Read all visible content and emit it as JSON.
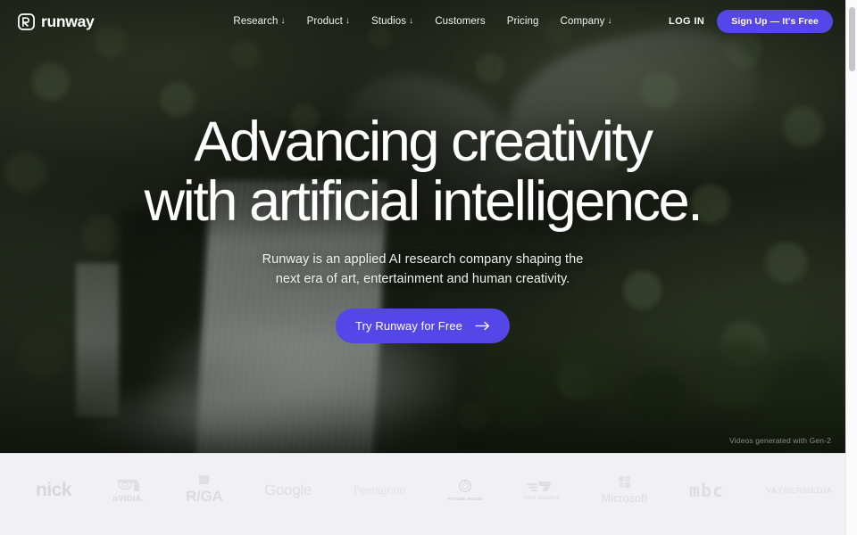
{
  "nav": {
    "logo_word": "runway",
    "links": [
      {
        "label": "Research",
        "caret": "↓"
      },
      {
        "label": "Product",
        "caret": "↓"
      },
      {
        "label": "Studios",
        "caret": "↓"
      },
      {
        "label": "Customers",
        "caret": ""
      },
      {
        "label": "Pricing",
        "caret": ""
      },
      {
        "label": "Company",
        "caret": "↓"
      }
    ],
    "login_label": "LOG IN",
    "signup_label": "Sign Up — It's Free"
  },
  "hero": {
    "headline_line1": "Advancing creativity",
    "headline_line2": "with artificial intelligence.",
    "subhead_line1": "Runway is an applied AI research company shaping the",
    "subhead_line2": "next era of art, entertainment and human creativity.",
    "cta_label": "Try Runway for Free",
    "caption": "Videos generated with Gen-2"
  },
  "logos": {
    "items": [
      {
        "name": "nick",
        "text": "nick"
      },
      {
        "name": "nvidia",
        "text": "nVIDIA."
      },
      {
        "name": "rga",
        "text": "R/GA"
      },
      {
        "name": "google",
        "text": "Google"
      },
      {
        "name": "pentagram",
        "text": "Pentagram"
      },
      {
        "name": "crest",
        "text": "PICTURE HOUSE"
      },
      {
        "name": "new-balance",
        "text": "new balance"
      },
      {
        "name": "microsoft",
        "text": "Microsoft"
      },
      {
        "name": "mbc",
        "text": "mbc"
      },
      {
        "name": "vayner",
        "text": "VAYNERMEDIA"
      }
    ]
  },
  "colors": {
    "accent_purple": "#5546e8",
    "hero_dark": "#1d2118",
    "logo_strip_bg": "#f1f1f4"
  }
}
